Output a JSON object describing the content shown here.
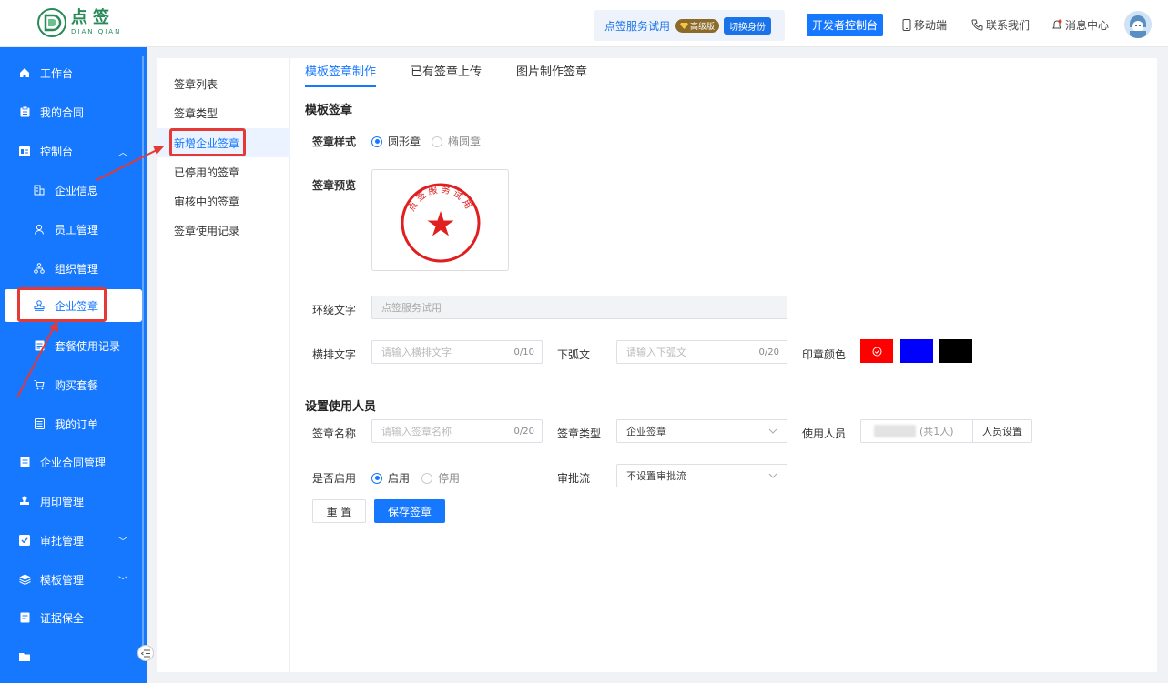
{
  "header": {
    "logo_cn": "点签",
    "logo_en": "DIAN QIAN",
    "trial_text": "点签服务试用",
    "vip_badge": "高级版",
    "switch_label": "切换身份",
    "dev_console": "开发者控制台",
    "mobile": "移动端",
    "contact": "联系我们",
    "messages": "消息中心"
  },
  "sidebar": {
    "items": [
      {
        "label": "工作台"
      },
      {
        "label": "我的合同"
      },
      {
        "label": "控制台"
      },
      {
        "label": "企业信息"
      },
      {
        "label": "员工管理"
      },
      {
        "label": "组织管理"
      },
      {
        "label": "企业签章"
      },
      {
        "label": "套餐使用记录"
      },
      {
        "label": "购买套餐"
      },
      {
        "label": "我的订单"
      },
      {
        "label": "企业合同管理"
      },
      {
        "label": "用印管理"
      },
      {
        "label": "审批管理"
      },
      {
        "label": "模板管理"
      },
      {
        "label": "证据保全"
      }
    ]
  },
  "submenu": {
    "items": [
      {
        "label": "签章列表"
      },
      {
        "label": "签章类型"
      },
      {
        "label": "新增企业签章"
      },
      {
        "label": "已停用的签章"
      },
      {
        "label": "审核中的签章"
      },
      {
        "label": "签章使用记录"
      }
    ]
  },
  "tabs": [
    {
      "label": "模板签章制作"
    },
    {
      "label": "已有签章上传"
    },
    {
      "label": "图片制作签章"
    }
  ],
  "form": {
    "section_template": "模板签章",
    "style_label": "签章样式",
    "style_round": "圆形章",
    "style_oval": "椭圆章",
    "preview_label": "签章预览",
    "seal_text": "点签服务试用",
    "surround_label": "环绕文字",
    "surround_value": "点签服务试用",
    "horizontal_label": "横排文字",
    "horizontal_placeholder": "请输入横排文字",
    "horizontal_count": "0/10",
    "lower_label": "下弧文",
    "lower_placeholder": "请输入下弧文",
    "lower_count": "0/20",
    "color_label": "印章颜色",
    "colors": [
      "#ff0000",
      "#0000ff",
      "#000000"
    ],
    "section_users": "设置使用人员",
    "name_label": "签章名称",
    "name_placeholder": "请输入签章名称",
    "name_count": "0/20",
    "type_label": "签章类型",
    "type_value": "企业签章",
    "users_label": "使用人员",
    "users_count": "(共1人)",
    "users_setting": "人员设置",
    "enable_label": "是否启用",
    "enable_on": "启用",
    "enable_off": "停用",
    "approval_label": "审批流",
    "approval_value": "不设置审批流",
    "reset_btn": "重 置",
    "save_btn": "保存签章"
  }
}
